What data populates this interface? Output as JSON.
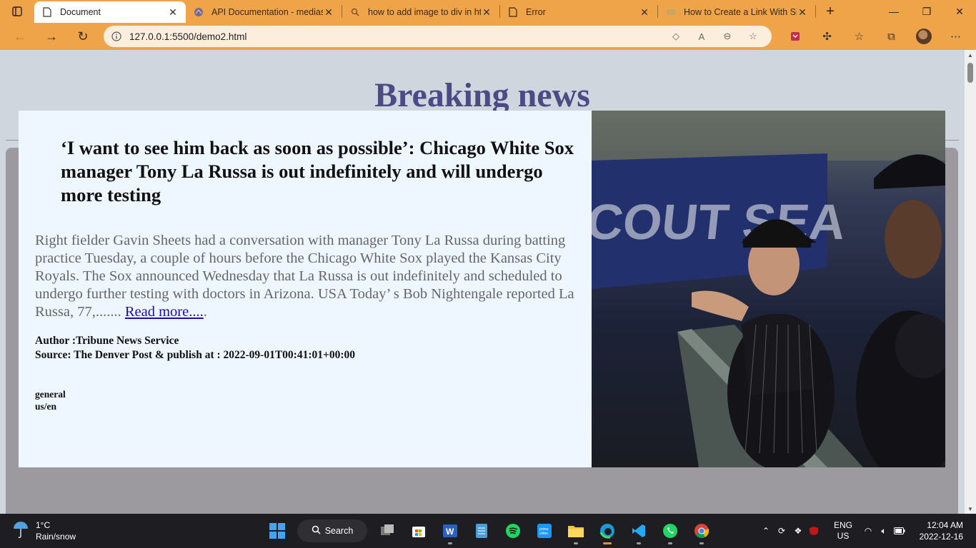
{
  "browser": {
    "tabs": [
      {
        "title": "Document",
        "active": true,
        "icon": "page-icon"
      },
      {
        "title": "API Documentation - mediast",
        "active": false,
        "icon": "mediastack-icon"
      },
      {
        "title": "how to add image to div in ht",
        "active": false,
        "icon": "search-icon"
      },
      {
        "title": "Error",
        "active": false,
        "icon": "page-icon"
      },
      {
        "title": "How to Create a Link With Sir",
        "active": false,
        "icon": "site-icon"
      }
    ],
    "url": "127.0.0.1:5500/demo2.html",
    "accent": "#f0a44a"
  },
  "page": {
    "title": "Breaking news",
    "article": {
      "headline": "‘I want to see him back as soon as possible’: Chicago White Sox manager Tony La Russa is out indefinitely and will undergo more testing",
      "description": "Right fielder Gavin Sheets had a conversation with manager Tony La Russa during batting practice Tuesday, a couple of hours before the Chicago White Sox played the Kansas City Royals. The Sox announced Wednesday that La Russa is out indefinitely and scheduled to undergo further testing with doctors in Arizona. USA Today’ s Bob Nightengale reported La Russa, 77,.......",
      "read_more": "Read more....",
      "read_more_suffix": ".",
      "author": "Author :Tribune News Service",
      "source": "Source: The Denver Post & publish at : 2022-09-01T00:41:01+00:00",
      "category": "general",
      "locale": "us/en"
    }
  },
  "taskbar": {
    "weather_temp": "1°C",
    "weather_desc": "Rain/snow",
    "search_label": "Search",
    "lang_top": "ENG",
    "lang_bottom": "US",
    "time": "12:04 AM",
    "date": "2022-12-16"
  }
}
